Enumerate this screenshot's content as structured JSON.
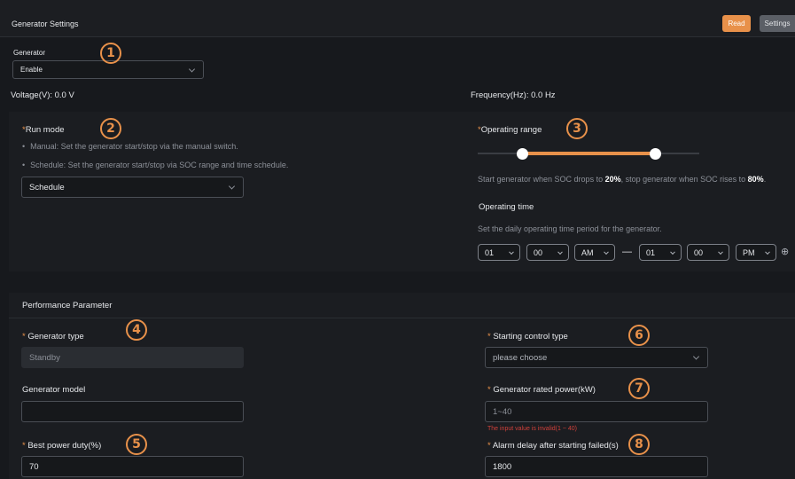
{
  "header": {
    "title": "Generator Settings",
    "read_label": "Read",
    "settings_label": "Settings"
  },
  "generator": {
    "label": "Generator",
    "value": "Enable"
  },
  "readings": {
    "voltage": "Voltage(V): 0.0 V",
    "frequency": "Frequency(Hz): 0.0 Hz"
  },
  "run_mode": {
    "label": "Run mode",
    "hint_manual": "Manual: Set the generator start/stop via the manual switch.",
    "hint_schedule": "Schedule: Set the generator start/stop via SOC range and time schedule.",
    "value": "Schedule"
  },
  "operating_range": {
    "label": "Operating range",
    "low_percent": 20,
    "high_percent": 80,
    "desc_pre": "Start generator when SOC drops to ",
    "low_text": "20%",
    "desc_mid": ", stop generator when SOC rises to ",
    "high_text": "80%",
    "desc_end": "."
  },
  "operating_time": {
    "label": "Operating time",
    "hint": "Set the daily operating time period for the generator.",
    "start_hour": "01",
    "start_min": "00",
    "start_ampm": "AM",
    "separator": "—",
    "end_hour": "01",
    "end_min": "00",
    "end_ampm": "PM",
    "add_icon": "⊕"
  },
  "performance": {
    "section_title": "Performance Parameter",
    "generator_type_label": "Generator type",
    "generator_type_value": "Standby",
    "generator_model_label": "Generator model",
    "generator_model_value": "",
    "best_power_label": "Best power duty(%)",
    "best_power_value": "70",
    "starting_control_label": "Starting control type",
    "starting_control_placeholder": "please choose",
    "rated_power_label": "Generator rated power(kW)",
    "rated_power_placeholder": "1~40",
    "rated_power_error": "The input value is invalid(1 ~ 40)",
    "alarm_delay_label": "Alarm delay after starting failed(s)",
    "alarm_delay_value": "1800"
  },
  "markers": [
    "1",
    "2",
    "3",
    "4",
    "5",
    "6",
    "7",
    "8"
  ],
  "colors": {
    "accent": "#e8914a",
    "error": "#d0403a",
    "background": "#17191d"
  }
}
